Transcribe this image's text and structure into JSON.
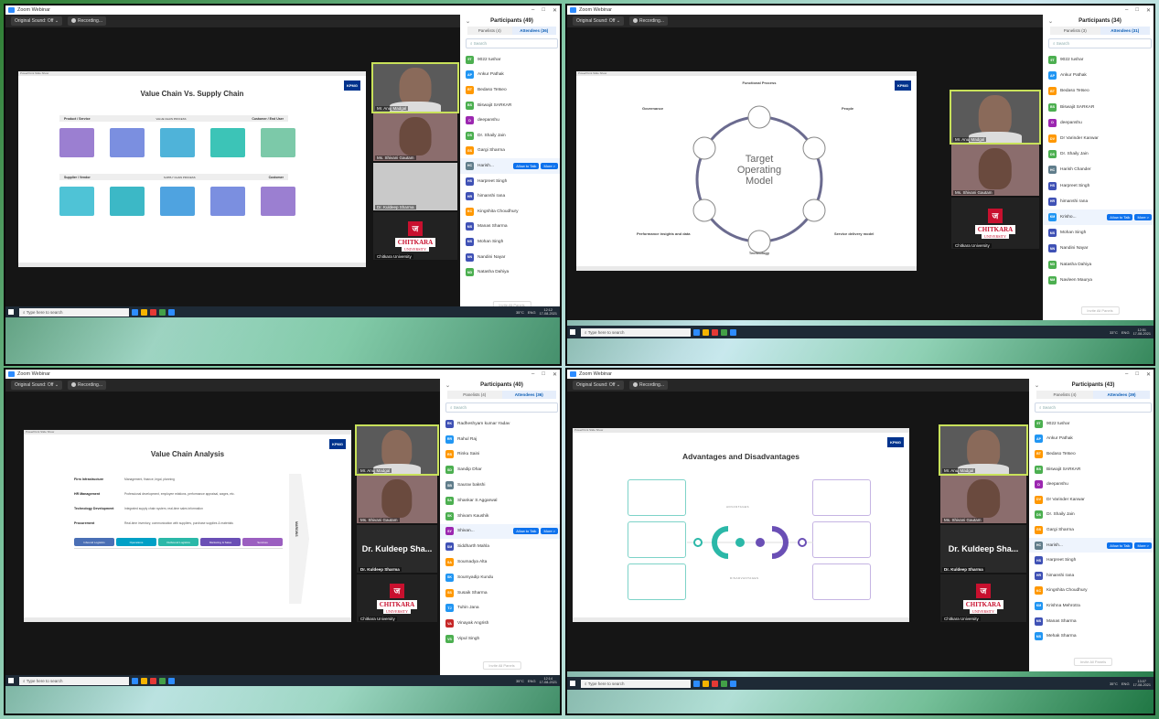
{
  "common": {
    "window_title": "Zoom Webinar",
    "original_sound": "Original Sound: Off",
    "recording": "Recording...",
    "search_placeholder": "Search",
    "taskbar_search": "Type here to search",
    "invite_label": "Invite All Panels",
    "allow_to_talk": "Allow to Talk",
    "more": "More >",
    "org_logo_word": "CHITKARA",
    "org_logo_sub": "UNIVERSITY",
    "kpmg": "KPMG"
  },
  "q1": {
    "slide_title": "Value Chain Vs. Supply Chain",
    "participants_title": "Participants (49)",
    "tab_panelists": "Panelists (4)",
    "tab_attendees": "Attendees (36)",
    "row1_left": "Product / Service",
    "row1_mid": "VALUE CHAIN PROCESS",
    "row1_right": "Customer / End User",
    "row2_left": "Supplier / Vendor",
    "row2_mid": "SUPPLY CHAIN PROCESS",
    "row2_right": "Customer",
    "videos": [
      "Mr. Anuj Madgal",
      "Ms. Shivani Gautam",
      "Dr. Kuldeep Sharma",
      "Chitkara University"
    ],
    "attendees": [
      {
        "initials": "9T",
        "name": "9022 tushar",
        "color": "#4caf50"
      },
      {
        "initials": "AP",
        "name": "Ankur Pathak",
        "color": "#2196f3"
      },
      {
        "initials": "BT",
        "name": "Bedaso Tetseo",
        "color": "#ff9800"
      },
      {
        "initials": "BS",
        "name": "Biswajit SARKAR",
        "color": "#4caf50"
      },
      {
        "initials": "D",
        "name": "deepanshu",
        "color": "#9c27b0"
      },
      {
        "initials": "DS",
        "name": "Dr. Shaily Jain",
        "color": "#4caf50"
      },
      {
        "initials": "GS",
        "name": "Gargi Sharma",
        "color": "#ff9800"
      },
      {
        "initials": "HC",
        "name": "Harish...",
        "color": "#607d8b"
      },
      {
        "initials": "HS",
        "name": "Harpreet Singh",
        "color": "#3f51b5"
      },
      {
        "initials": "HR",
        "name": "himanshi rana",
        "color": "#3f51b5"
      },
      {
        "initials": "KC",
        "name": "Kingshita Choudhury",
        "color": "#ff9800"
      },
      {
        "initials": "MS",
        "name": "Manas Sharma",
        "color": "#3f51b5"
      },
      {
        "initials": "MS",
        "name": "Mohan Singh",
        "color": "#3f51b5"
      },
      {
        "initials": "NN",
        "name": "Nandini Nayar",
        "color": "#3f51b5"
      },
      {
        "initials": "ND",
        "name": "Natasha Dahiya",
        "color": "#4caf50"
      }
    ],
    "clock_time": "12:12",
    "clock_date": "17-08-2021",
    "temp": "35°C",
    "lang": "ENG"
  },
  "q2": {
    "slide_center_line1": "Target",
    "slide_center_line2": "Operating",
    "slide_center_line3": "Model",
    "node_top": "Functional Process",
    "node_tl": "Governance",
    "node_tr": "People",
    "node_bl": "Performance insights and data",
    "node_b": "Technology",
    "node_br": "Service delivery model",
    "participants_title": "Participants (34)",
    "tab_panelists": "Panelists (3)",
    "tab_attendees": "Attendees (31)",
    "videos": [
      "Mr. Anuj Madgal",
      "Ms. Shivani Gautam",
      "Chitkara University"
    ],
    "attendees": [
      {
        "initials": "9T",
        "name": "9022 tushar",
        "color": "#4caf50"
      },
      {
        "initials": "AP",
        "name": "Ankur Pathak",
        "color": "#2196f3"
      },
      {
        "initials": "BT",
        "name": "Bedaso Tetseo",
        "color": "#ff9800"
      },
      {
        "initials": "BS",
        "name": "Biswajit SARKAR",
        "color": "#4caf50"
      },
      {
        "initials": "D",
        "name": "deepanshu",
        "color": "#9c27b0"
      },
      {
        "initials": "DV",
        "name": "Dr Varinder Kanwar",
        "color": "#ff9800"
      },
      {
        "initials": "DS",
        "name": "Dr. Shaily Jain",
        "color": "#4caf50"
      },
      {
        "initials": "HC",
        "name": "Harish Chander",
        "color": "#607d8b"
      },
      {
        "initials": "HS",
        "name": "Harpreet Singh",
        "color": "#3f51b5"
      },
      {
        "initials": "HR",
        "name": "himanshi rana",
        "color": "#3f51b5"
      },
      {
        "initials": "KM",
        "name": "Krisho...",
        "color": "#2196f3"
      },
      {
        "initials": "MS",
        "name": "Mohan Singh",
        "color": "#3f51b5"
      },
      {
        "initials": "NN",
        "name": "Nandini Nayar",
        "color": "#3f51b5"
      },
      {
        "initials": "ND",
        "name": "Natasha Dahiya",
        "color": "#4caf50"
      },
      {
        "initials": "NM",
        "name": "Navleen Maurya",
        "color": "#4caf50"
      }
    ],
    "clock_time": "12:51",
    "clock_date": "17-08-2021",
    "temp": "33°C",
    "lang": "ENG"
  },
  "q3": {
    "slide_title": "Value Chain Analysis",
    "support_rows": [
      {
        "label": "Firm Infrastructure",
        "text": "Management, finance, legal, planning"
      },
      {
        "label": "HR Management",
        "text": "Professional development, employee relations, performance appraisal, wages, etc."
      },
      {
        "label": "Technology Development",
        "text": "Integrated supply chain system, real-time sales information"
      },
      {
        "label": "Procurement",
        "text": "Real-time inventory, communication with suppliers, purchase supplies & materials"
      }
    ],
    "primary": [
      "Inbound Logistics",
      "Operations",
      "Outbound Logistics",
      "Marketing & Sales",
      "Services"
    ],
    "margins": "MARGINS",
    "speaker_name": "Dr. Kuldeep Sha...",
    "participants_title": "Participants (40)",
    "tab_panelists": "Panelists (4)",
    "tab_attendees": "Attendees (36)",
    "videos": [
      "Mr. Anuj Madgal",
      "Ms. Shivani Gautam",
      "Dr. Kuldeep Sharma",
      "Chitkara University"
    ],
    "attendees": [
      {
        "initials": "RK",
        "name": "Radheshyam kumar Yadav",
        "color": "#3f51b5"
      },
      {
        "initials": "RR",
        "name": "Rahul Raj",
        "color": "#2196f3"
      },
      {
        "initials": "RS",
        "name": "Rinku Saini",
        "color": "#ff9800"
      },
      {
        "initials": "SD",
        "name": "Sandip Dhar",
        "color": "#4caf50"
      },
      {
        "initials": "SB",
        "name": "Saurav bakshi",
        "color": "#607d8b"
      },
      {
        "initials": "SA",
        "name": "Shankar S Aggarwal",
        "color": "#4caf50"
      },
      {
        "initials": "SK",
        "name": "Shivam Kaushik",
        "color": "#4caf50"
      },
      {
        "initials": "SY",
        "name": "Shivan...",
        "color": "#9c27b0"
      },
      {
        "initials": "SM",
        "name": "Siddharth Mahla",
        "color": "#3f51b5"
      },
      {
        "initials": "SA",
        "name": "Soumadya Alta",
        "color": "#ff9800"
      },
      {
        "initials": "SK",
        "name": "Soumyadip Kundu",
        "color": "#2196f3"
      },
      {
        "initials": "SS",
        "name": "Susaik Sharma",
        "color": "#ff9800"
      },
      {
        "initials": "TJ",
        "name": "Tuhin Jana",
        "color": "#2196f3"
      },
      {
        "initials": "VA",
        "name": "Vinayak Angrish",
        "color": "#c62828"
      },
      {
        "initials": "VS",
        "name": "Vipul Singh",
        "color": "#4caf50"
      }
    ],
    "clock_time": "12:14",
    "clock_date": "17-08-2021",
    "temp": "35°C",
    "lang": "ENG"
  },
  "q4": {
    "slide_title": "Advantages and Disadvantages",
    "arc_top": "ADVANTAGES",
    "arc_bottom": "DISADVANTAGES",
    "speaker_name": "Dr. Kuldeep Sha...",
    "participants_title": "Participants (43)",
    "tab_panelists": "Panelists (4)",
    "tab_attendees": "Attendees (39)",
    "videos": [
      "Mr. Anuj Madgal",
      "Ms. Shivani Gautam",
      "Dr. Kuldeep Sharma",
      "Chitkara University"
    ],
    "attendees": [
      {
        "initials": "9T",
        "name": "9022 tushar",
        "color": "#4caf50"
      },
      {
        "initials": "AP",
        "name": "Ankur Pathak",
        "color": "#2196f3"
      },
      {
        "initials": "BT",
        "name": "Bedaso Tetseo",
        "color": "#ff9800"
      },
      {
        "initials": "BS",
        "name": "Biswajit SARKAR",
        "color": "#4caf50"
      },
      {
        "initials": "D",
        "name": "deepanshu",
        "color": "#9c27b0"
      },
      {
        "initials": "DV",
        "name": "Dr Varinder Kanwar",
        "color": "#ff9800"
      },
      {
        "initials": "DS",
        "name": "Dr. Shaily Jain",
        "color": "#4caf50"
      },
      {
        "initials": "GS",
        "name": "Gargi Sharma",
        "color": "#ff9800"
      },
      {
        "initials": "HC",
        "name": "Harish...",
        "color": "#607d8b"
      },
      {
        "initials": "HS",
        "name": "Harpreet Singh",
        "color": "#3f51b5"
      },
      {
        "initials": "HR",
        "name": "himanshi rana",
        "color": "#3f51b5"
      },
      {
        "initials": "KC",
        "name": "Kingshita Choudhury",
        "color": "#ff9800"
      },
      {
        "initials": "KM",
        "name": "Krishna Mehrotra",
        "color": "#2196f3"
      },
      {
        "initials": "MS",
        "name": "Manas Sharma",
        "color": "#3f51b5"
      },
      {
        "initials": "MS",
        "name": "Mehak Sharma",
        "color": "#2196f3"
      }
    ],
    "clock_time": "13:07",
    "clock_date": "17-08-2021",
    "temp": "35°C",
    "lang": "ENG"
  }
}
